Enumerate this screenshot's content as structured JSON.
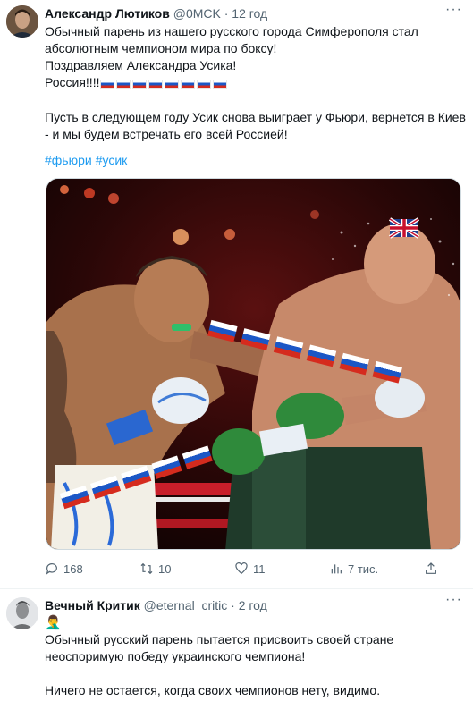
{
  "tweet1": {
    "author_name": "Александр Лютиков",
    "handle": "@0MCK",
    "separator": "·",
    "time": "12 год",
    "more_label": "···",
    "lines": [
      "Обычный парень из нашего русского города Симферополя стал",
      "абсолютным чемпионом мира по боксу!",
      "Поздравляем Александра Усика!",
      "Россия!!!!"
    ],
    "flag_count": 8,
    "lines2": [
      "Пусть в следующем году Усик снова выиграет у Фьюри, вернется в Киев",
      "- и мы будем встречать его всей Россией!"
    ],
    "hashtags": [
      "#фьюри",
      "#усик"
    ],
    "photo_icon": "boxing-match-photo",
    "actions": {
      "reply_count": "168",
      "retweet_count": "10",
      "like_count": "11",
      "views_count": "7 тис."
    }
  },
  "tweet2": {
    "author_name": "Вечный Критик",
    "handle": "@eternal_critic",
    "separator": "·",
    "time": "2 год",
    "more_label": "···",
    "emoji": "🤦‍♂️",
    "lines": [
      "Обычный русский парень пытается присвоить своей стране",
      "неоспоримую победу украинского чемпиона!"
    ],
    "lines2": [
      "Ничего не остается, когда своих чемпионов нету, видимо."
    ]
  },
  "colors": {
    "text": "#0f1419",
    "secondary": "#536471",
    "link": "#1d9bf0",
    "border": "#eff3f4"
  }
}
